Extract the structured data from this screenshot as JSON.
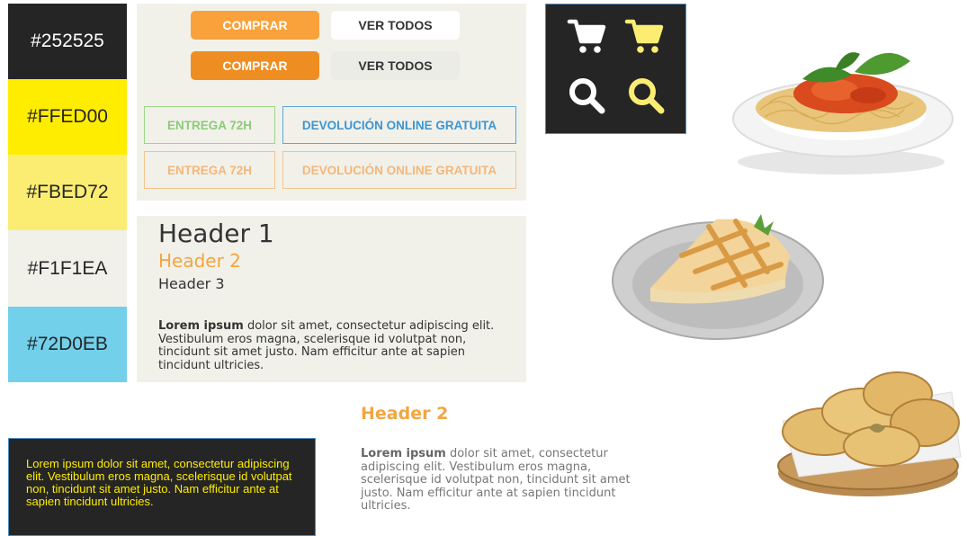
{
  "palette": [
    {
      "label": "#252525",
      "color": "#252525"
    },
    {
      "label": "#FFED00",
      "color": "#FFED00"
    },
    {
      "label": "#FBED72",
      "color": "#FBED72"
    },
    {
      "label": "#F1F1EA",
      "color": "#F1F1EA"
    },
    {
      "label": "#72D0EB",
      "color": "#72D0EB"
    }
  ],
  "buttons": {
    "buy_primary": "COMPRAR",
    "view_all_primary": "VER TODOS",
    "buy_hover": "COMPRAR",
    "view_all_hover": "VER TODOS"
  },
  "tags": {
    "delivery_green": "ENTREGA 72H",
    "returns_blue": "DEVOLUCIÓN ONLINE GRATUITA",
    "delivery_peach": "ENTREGA 72H",
    "returns_peach": "DEVOLUCIÓN ONLINE GRATUITA"
  },
  "icons": [
    "cart-icon-white",
    "cart-icon-yellow",
    "search-icon-white",
    "search-icon-yellow"
  ],
  "typography": {
    "header1": "Header 1",
    "header2": "Header 2",
    "header3": "Header 3",
    "paragraph_bold": "Lorem ipsum",
    "paragraph_rest": " dolor sit amet, consectetur adipiscing elit. Vestibulum eros magna, scelerisque id volutpat non, tincidunt sit amet justo. Nam efficitur ante at sapien tincidunt ultricies."
  },
  "bottom_text": {
    "header2": "Header 2",
    "paragraph_bold": "Lorem ipsum",
    "paragraph_rest": " dolor sit amet, consectetur adipiscing elit. Vestibulum eros magna, scelerisque id volutpat non, tincidunt sit amet justo. Nam efficitur ante at sapien tincidunt ultricies."
  },
  "dark_box": {
    "text": "Lorem ipsum dolor sit amet, consectetur adipiscing elit. Vestibulum eros magna, scelerisque id volutpat non, tincidunt sit amet justo. Nam efficitur ante at sapien tincidunt ultricies."
  },
  "images": [
    "spaghetti-image",
    "apple-pie-image",
    "empanadas-image"
  ]
}
